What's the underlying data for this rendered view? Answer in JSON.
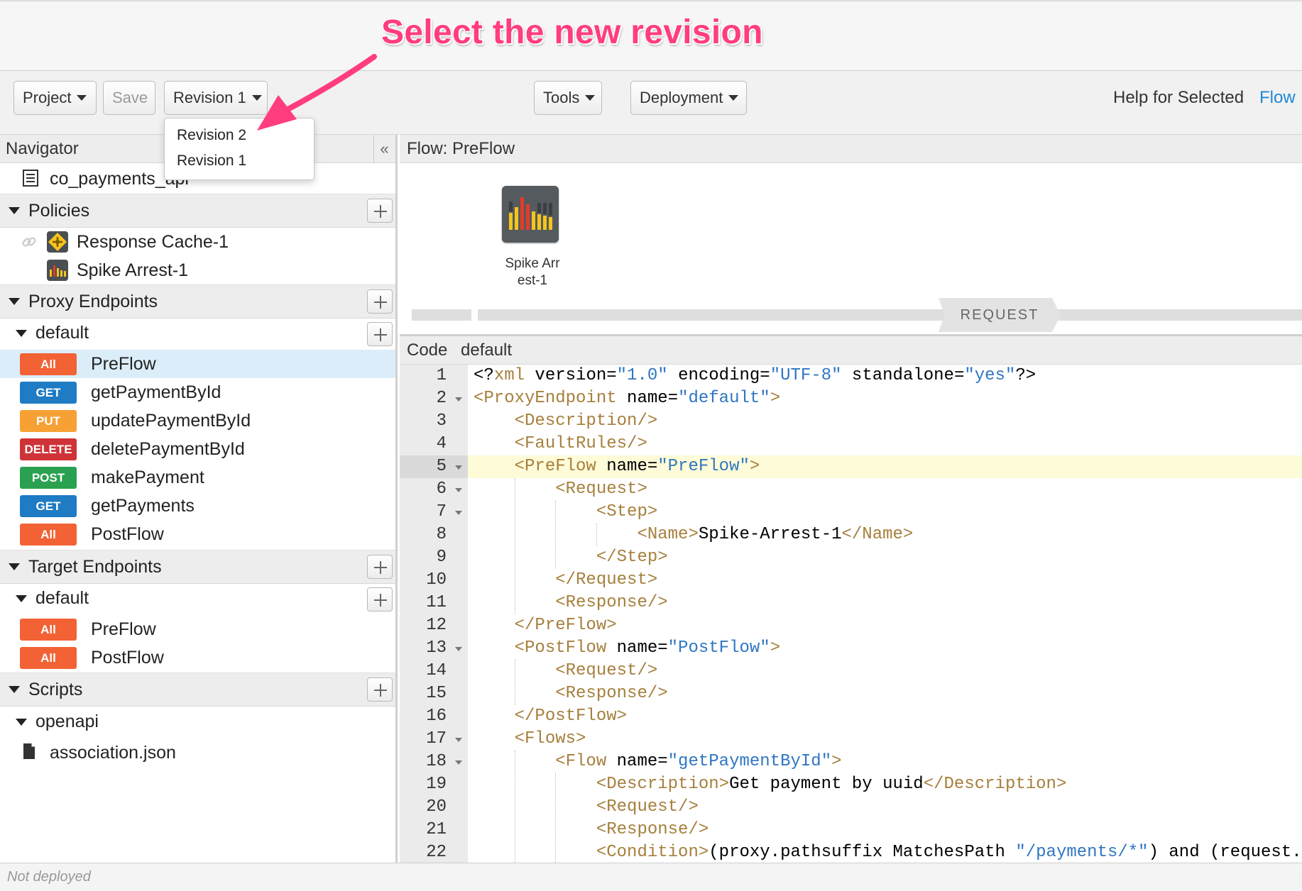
{
  "annotation": {
    "text": "Select the new revision",
    "color": "#ff3d7f"
  },
  "toolbar": {
    "project_label": "Project",
    "save_label": "Save",
    "revision_label": "Revision 1",
    "tools_label": "Tools",
    "deployment_label": "Deployment",
    "help_label": "Help for Selected",
    "help_link": "Flow"
  },
  "revision_menu": {
    "items": [
      "Revision 2",
      "Revision 1"
    ]
  },
  "navigator": {
    "title": "Navigator",
    "collapse_icon": "«",
    "proxy_name": "co_payments_api",
    "sections": {
      "policies": "Policies",
      "proxy_endpoints": "Proxy Endpoints",
      "target_endpoints": "Target Endpoints",
      "scripts": "Scripts"
    },
    "policies": [
      {
        "name": "Response Cache-1",
        "icon": "response-cache-icon"
      },
      {
        "name": "Spike Arrest-1",
        "icon": "spike-arrest-icon"
      }
    ],
    "proxy_default_label": "default",
    "proxy_flows": [
      {
        "method": "All",
        "name": "PreFlow",
        "color": "#f26235"
      },
      {
        "method": "GET",
        "name": "getPaymentById",
        "color": "#1e7bc4"
      },
      {
        "method": "PUT",
        "name": "updatePaymentById",
        "color": "#f7a135"
      },
      {
        "method": "DELETE",
        "name": "deletePaymentById",
        "color": "#cf3337"
      },
      {
        "method": "POST",
        "name": "makePayment",
        "color": "#2aa150"
      },
      {
        "method": "GET",
        "name": "getPayments",
        "color": "#1e7bc4"
      },
      {
        "method": "All",
        "name": "PostFlow",
        "color": "#f26235"
      }
    ],
    "target_default_label": "default",
    "target_flows": [
      {
        "method": "All",
        "name": "PreFlow",
        "color": "#f26235"
      },
      {
        "method": "All",
        "name": "PostFlow",
        "color": "#f26235"
      }
    ],
    "scripts_folder": "openapi",
    "script_file": "association.json",
    "selected_color": "#dcedfa"
  },
  "flow_panel": {
    "title": "Flow: PreFlow",
    "step_label_line1": "Spike Arr",
    "step_label_line2": "est-1",
    "request_label": "REQUEST"
  },
  "code_panel": {
    "tab_code": "Code",
    "tab_file": "default",
    "active_line": 5,
    "lines": [
      "<?xml version=\"1.0\" encoding=\"UTF-8\" standalone=\"yes\"?>",
      "<ProxyEndpoint name=\"default\">",
      "    <Description/>",
      "    <FaultRules/>",
      "    <PreFlow name=\"PreFlow\">",
      "        <Request>",
      "            <Step>",
      "                <Name>Spike-Arrest-1</Name>",
      "            </Step>",
      "        </Request>",
      "        <Response/>",
      "    </PreFlow>",
      "    <PostFlow name=\"PostFlow\">",
      "        <Request/>",
      "        <Response/>",
      "    </PostFlow>",
      "    <Flows>",
      "        <Flow name=\"getPaymentById\">",
      "            <Description>Get payment by uuid</Description>",
      "            <Request/>",
      "            <Response/>",
      "            <Condition>(proxy.pathsuffix MatchesPath \"/payments/*\") and (request."
    ],
    "foldable_lines": [
      2,
      5,
      6,
      7,
      13,
      17,
      18
    ]
  },
  "status_bar": {
    "text": "Not deployed"
  }
}
